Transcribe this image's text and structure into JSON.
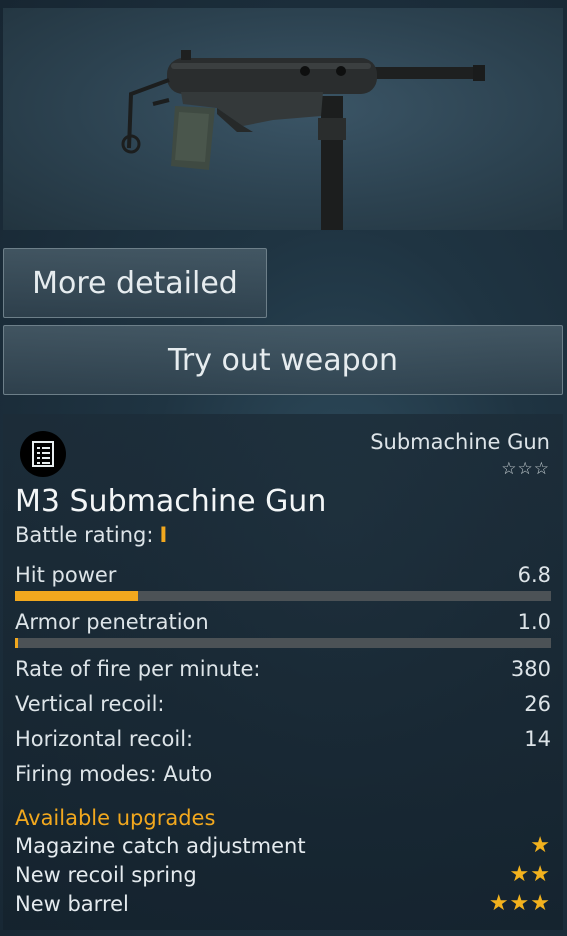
{
  "preview": {
    "image": "m3-submachine-gun-render"
  },
  "buttons": {
    "more_detailed": "More detailed",
    "try_out": "Try out weapon"
  },
  "card": {
    "icon": "document-list-icon",
    "weapon_class": "Submachine Gun",
    "rank_stars": "☆☆☆",
    "title": "M3 Submachine Gun",
    "battle_rating_label": "Battle rating:",
    "battle_rating_value": "I",
    "stats": {
      "hit_power": {
        "label": "Hit power",
        "value": "6.8",
        "fill_fraction": 0.23
      },
      "armor_penetration": {
        "label": "Armor penetration",
        "value": "1.0",
        "fill_fraction": 0.005
      },
      "rate_of_fire": {
        "label": "Rate of fire per minute:",
        "value": "380"
      },
      "vertical_recoil": {
        "label": "Vertical recoil:",
        "value": "26"
      },
      "horizontal_recoil": {
        "label": "Horizontal recoil:",
        "value": "14"
      },
      "firing_modes": {
        "label": "Firing modes: Auto"
      }
    },
    "upgrades": {
      "title": "Available upgrades",
      "items": [
        {
          "label": "Magazine catch adjustment",
          "stars": "★"
        },
        {
          "label": "New recoil spring",
          "stars": "★★"
        },
        {
          "label": "New barrel",
          "stars": "★★★"
        }
      ]
    }
  },
  "colors": {
    "accent": "#f2a81e",
    "bar_track": "#4c5256"
  }
}
